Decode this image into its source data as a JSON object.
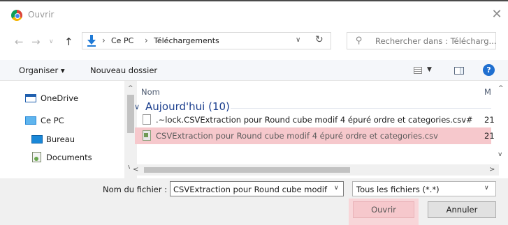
{
  "window": {
    "title": "Ouvrir",
    "close": "✕"
  },
  "nav": {
    "back": "←",
    "forward": "→",
    "recent": "∨",
    "up": "↑"
  },
  "address": {
    "sep1": "›",
    "crumb1": "Ce PC",
    "sep2": "›",
    "crumb2": "Téléchargements",
    "dropdown": "∨",
    "refresh": "↻"
  },
  "search": {
    "placeholder": "Rechercher dans : Télécharg..."
  },
  "toolbar": {
    "organise": "Organiser ▾",
    "new_folder": "Nouveau dossier",
    "view_dropdown": "▼",
    "help": "?"
  },
  "tree": {
    "items": [
      {
        "label": "OneDrive",
        "icon": "onedrive-icon"
      },
      {
        "label": "Ce PC",
        "icon": "computer-icon"
      },
      {
        "label": "Bureau",
        "icon": "desktop-icon"
      },
      {
        "label": "Documents",
        "icon": "documents-icon"
      }
    ],
    "scroll_up": "^",
    "scroll_down": "v"
  },
  "list": {
    "col_name": "Nom",
    "col_m": "M",
    "group_chevron": "∨",
    "group_label": "Aujourd'hui (10)",
    "rows": [
      {
        "name": ".~lock.CSVExtraction pour Round cube modif 4 épuré ordre et categories.csv#",
        "num": "21",
        "icon": "file-icon"
      },
      {
        "name": "CSVExtraction pour Round cube modif 4 épuré ordre et categories.csv",
        "num": "21",
        "icon": "csv-file-icon"
      }
    ],
    "scroll_up": "^",
    "scroll_down": "v",
    "hscroll_left": "<",
    "hscroll_right": ">"
  },
  "bottom": {
    "filename_label": "Nom du fichier :",
    "filename_value": "CSVExtraction pour Round cube modif",
    "filename_dd": "∨",
    "filter_value": "Tous les fichiers (*.*)",
    "filter_dd": "∨",
    "open_label": "Ouvrir",
    "cancel_label": "Annuler"
  },
  "colors": {
    "selection": "#f6c8cc",
    "group_label": "#1c3f8e",
    "help": "#1f6fd0"
  }
}
